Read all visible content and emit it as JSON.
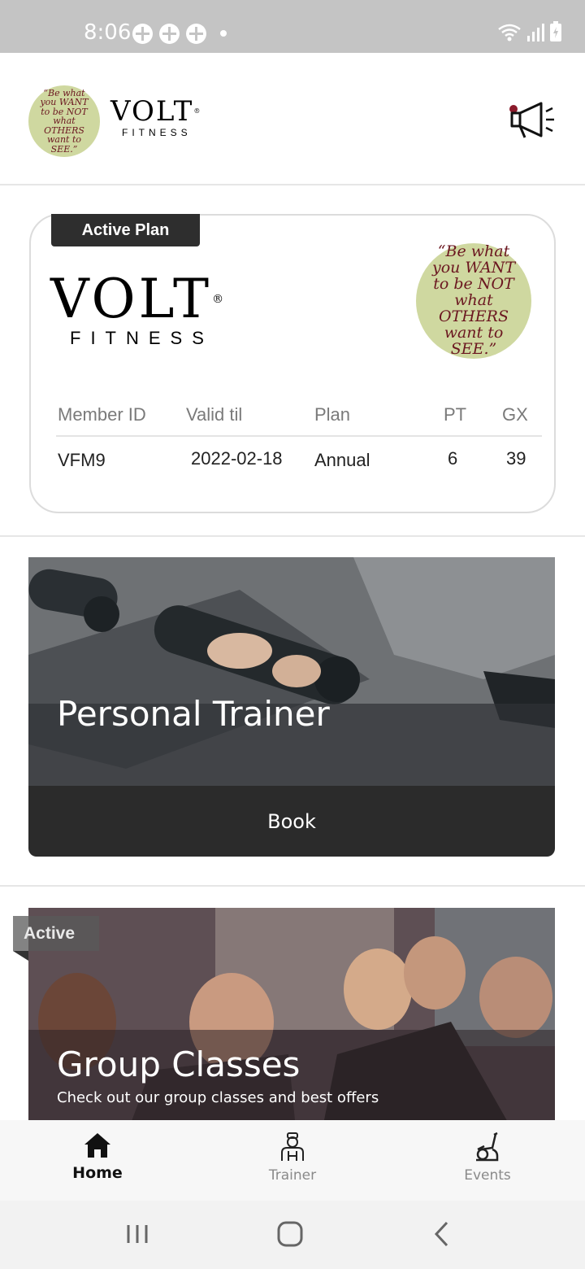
{
  "status_bar": {
    "time": "8:06",
    "background": "#c4c4c4"
  },
  "header": {
    "quote_text": "“Be what you WANT to be NOT what OTHERS want to SEE.”",
    "brand_name": "VOLT",
    "brand_subtitle": "FITNESS",
    "brand_registered": "®",
    "announce_icon": "megaphone-icon"
  },
  "plan_card": {
    "tag_label": "Active Plan",
    "brand_name": "VOLT",
    "brand_subtitle": "FITNESS",
    "brand_registered": "®",
    "quote_text": "“Be what you WANT to be NOT what OTHERS want to SEE.”",
    "columns": [
      "Member ID",
      "Valid til",
      "Plan",
      "PT",
      "GX"
    ],
    "values": [
      "VFM9",
      "2022-02-18",
      "Annual",
      "6",
      "39"
    ]
  },
  "personal_trainer": {
    "title": "Personal Trainer",
    "button_label": "Book"
  },
  "group_classes": {
    "badge_label": "Active",
    "title": "Group Classes",
    "subtitle": "Check out our group classes and best offers"
  },
  "bottom_nav": {
    "items": [
      {
        "label": "Home",
        "icon": "home-icon",
        "active": true
      },
      {
        "label": "Trainer",
        "icon": "trainer-icon",
        "active": false
      },
      {
        "label": "Events",
        "icon": "exercise-bike-icon",
        "active": false
      }
    ]
  },
  "system_nav": {
    "buttons": [
      "recents-icon",
      "home-circle-icon",
      "back-icon"
    ]
  },
  "colors": {
    "dark": "#2b2b2b",
    "quote_badge": "#cfd8a0",
    "quote_text": "#6b1720"
  }
}
